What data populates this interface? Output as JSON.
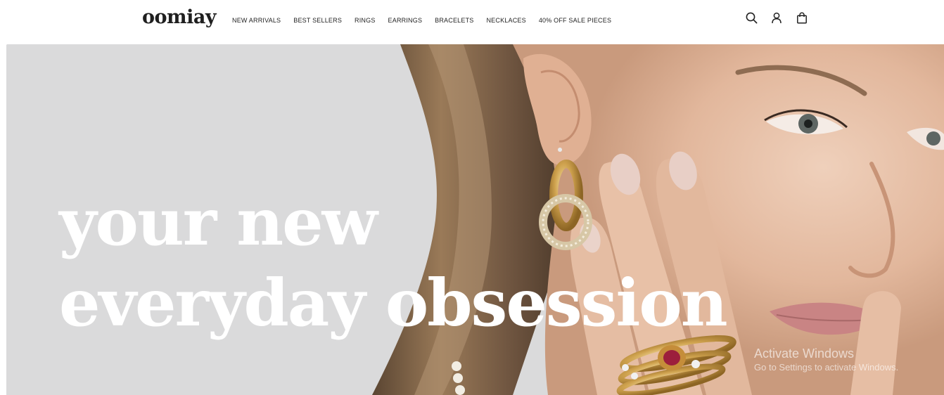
{
  "brand": {
    "logo_text": "oomiay"
  },
  "nav": {
    "items": [
      {
        "label": "NEW ARRIVALS"
      },
      {
        "label": "BEST SELLERS"
      },
      {
        "label": "RINGS"
      },
      {
        "label": "EARRINGS"
      },
      {
        "label": "BRACELETS"
      },
      {
        "label": "NECKLACES"
      },
      {
        "label": "40% OFF SALE PIECES"
      }
    ]
  },
  "header_icons": {
    "search": "search-icon",
    "account": "user-icon",
    "cart": "shopping-bag-icon"
  },
  "hero": {
    "headline_line1_a": "your",
    "headline_line1_b": "new",
    "headline_line2_a": "everyday",
    "headline_line2_b": "obsession"
  },
  "os_watermark": {
    "title": "Activate Windows",
    "subtitle": "Go to Settings to activate Windows."
  },
  "colors": {
    "text_dark": "#222222",
    "hero_text": "#ffffff",
    "hero_background": "#dcdcdc",
    "gold": "#c9a04a"
  }
}
